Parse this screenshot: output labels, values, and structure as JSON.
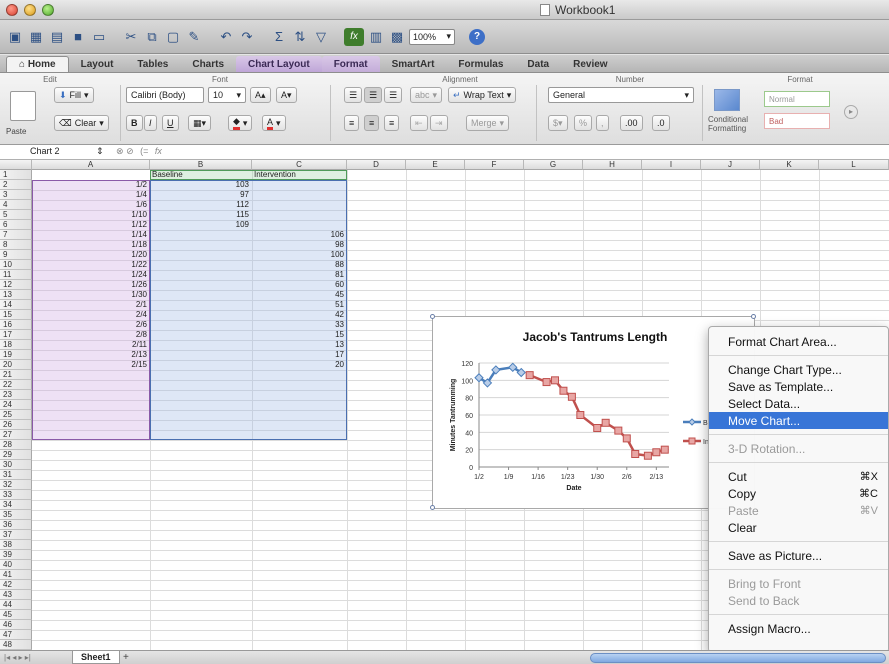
{
  "window": {
    "title": "Workbook1"
  },
  "toolbar": {
    "zoom": "100%",
    "fx_label": "fx"
  },
  "ribbon_tabs": [
    {
      "label": "Home",
      "active": true
    },
    {
      "label": "Layout"
    },
    {
      "label": "Tables"
    },
    {
      "label": "Charts"
    },
    {
      "label": "Chart Layout"
    },
    {
      "label": "Format"
    },
    {
      "label": "SmartArt"
    },
    {
      "label": "Formulas"
    },
    {
      "label": "Data"
    },
    {
      "label": "Review"
    }
  ],
  "ribbon": {
    "groups": {
      "edit": "Edit",
      "font": "Font",
      "alignment": "Alignment",
      "number": "Number",
      "format": "Format"
    },
    "paste": "Paste",
    "fill": "Fill",
    "clear": "Clear",
    "font_name": "Calibri (Body)",
    "font_size": "10",
    "wrap_text": "Wrap Text",
    "merge": "Merge",
    "abc": "abc",
    "number_format": "General",
    "conditional_formatting": "Conditional Formatting",
    "style_normal": "Normal",
    "style_bad": "Bad"
  },
  "formula_bar": {
    "name_box": "Chart 2",
    "fx": "fx"
  },
  "columns": [
    "A",
    "B",
    "C",
    "D",
    "E",
    "F",
    "G",
    "H",
    "I",
    "J",
    "K",
    "L"
  ],
  "headers": {
    "b": "Baseline",
    "c": "Intervention"
  },
  "rows": [
    {
      "a": "1/2",
      "b": "103",
      "c": ""
    },
    {
      "a": "1/4",
      "b": "97",
      "c": ""
    },
    {
      "a": "1/6",
      "b": "112",
      "c": ""
    },
    {
      "a": "1/10",
      "b": "115",
      "c": ""
    },
    {
      "a": "1/12",
      "b": "109",
      "c": ""
    },
    {
      "a": "1/14",
      "b": "",
      "c": "106"
    },
    {
      "a": "1/18",
      "b": "",
      "c": "98"
    },
    {
      "a": "1/20",
      "b": "",
      "c": "100"
    },
    {
      "a": "1/22",
      "b": "",
      "c": "88"
    },
    {
      "a": "1/24",
      "b": "",
      "c": "81"
    },
    {
      "a": "1/26",
      "b": "",
      "c": "60"
    },
    {
      "a": "1/30",
      "b": "",
      "c": "45"
    },
    {
      "a": "2/1",
      "b": "",
      "c": "51"
    },
    {
      "a": "2/4",
      "b": "",
      "c": "42"
    },
    {
      "a": "2/6",
      "b": "",
      "c": "33"
    },
    {
      "a": "2/8",
      "b": "",
      "c": "15"
    },
    {
      "a": "2/11",
      "b": "",
      "c": "13"
    },
    {
      "a": "2/13",
      "b": "",
      "c": "17"
    },
    {
      "a": "2/15",
      "b": "",
      "c": "20"
    }
  ],
  "chart_data": {
    "type": "line",
    "title": "Jacob's Tantrums Length",
    "xlabel": "Date",
    "ylabel": "Minutes Tantrumming",
    "ylim": [
      0,
      120
    ],
    "y_ticks": [
      0,
      20,
      40,
      60,
      80,
      100,
      120
    ],
    "x_ticks": [
      "1/2",
      "1/9",
      "1/16",
      "1/23",
      "1/30",
      "2/6",
      "2/13"
    ],
    "x_tick_days": [
      0,
      7,
      14,
      21,
      28,
      35,
      42
    ],
    "x_range_days": [
      0,
      45
    ],
    "legend": [
      "Ba",
      "Int"
    ],
    "series": [
      {
        "name": "Baseline",
        "color": "#4a7ebb",
        "marker": "diamond",
        "x": [
          "1/2",
          "1/4",
          "1/6",
          "1/10",
          "1/12"
        ],
        "x_days": [
          0,
          2,
          4,
          8,
          10
        ],
        "values": [
          103,
          97,
          112,
          115,
          109
        ]
      },
      {
        "name": "Intervention",
        "color": "#c0504d",
        "marker": "square",
        "x": [
          "1/14",
          "1/18",
          "1/20",
          "1/22",
          "1/24",
          "1/26",
          "1/30",
          "2/1",
          "2/4",
          "2/6",
          "2/8",
          "2/11",
          "2/13",
          "2/15"
        ],
        "x_days": [
          12,
          16,
          18,
          20,
          22,
          24,
          28,
          30,
          33,
          35,
          37,
          40,
          42,
          44
        ],
        "values": [
          106,
          98,
          100,
          88,
          81,
          60,
          45,
          51,
          42,
          33,
          15,
          13,
          17,
          20
        ]
      }
    ]
  },
  "context_menu": {
    "items": [
      {
        "label": "Format Chart Area...",
        "shortcut": "",
        "disabled": false
      },
      {
        "sep": true
      },
      {
        "label": "Change Chart Type...",
        "shortcut": "",
        "disabled": false
      },
      {
        "label": "Save as Template...",
        "shortcut": "",
        "disabled": false
      },
      {
        "label": "Select Data...",
        "shortcut": "",
        "disabled": false
      },
      {
        "label": "Move Chart...",
        "shortcut": "",
        "disabled": false,
        "highlighted": true
      },
      {
        "sep": true
      },
      {
        "label": "3-D Rotation...",
        "shortcut": "",
        "disabled": true
      },
      {
        "sep": true
      },
      {
        "label": "Cut",
        "shortcut": "⌘X",
        "disabled": false
      },
      {
        "label": "Copy",
        "shortcut": "⌘C",
        "disabled": false
      },
      {
        "label": "Paste",
        "shortcut": "⌘V",
        "disabled": true
      },
      {
        "label": "Clear",
        "shortcut": "",
        "disabled": false
      },
      {
        "sep": true
      },
      {
        "label": "Save as Picture...",
        "shortcut": "",
        "disabled": false
      },
      {
        "sep": true
      },
      {
        "label": "Bring to Front",
        "shortcut": "",
        "disabled": true
      },
      {
        "label": "Send to Back",
        "shortcut": "",
        "disabled": true
      },
      {
        "sep": true
      },
      {
        "label": "Assign Macro...",
        "shortcut": "",
        "disabled": false
      }
    ]
  },
  "sheet_tabs": {
    "active": "Sheet1",
    "add": "+"
  }
}
